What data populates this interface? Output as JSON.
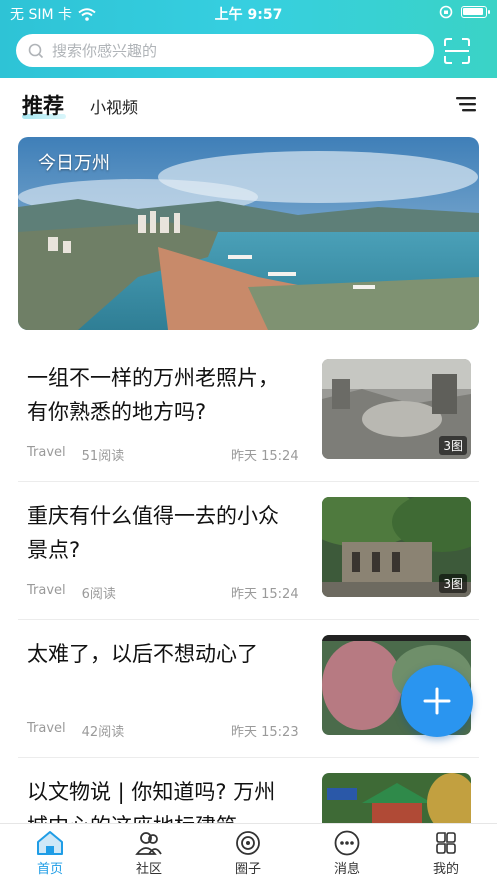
{
  "status_bar": {
    "carrier": "无 SIM 卡",
    "time": "上午 9:57"
  },
  "search": {
    "placeholder": "搜索你感兴趣的"
  },
  "tabs": {
    "main": "推荐",
    "second": "小视频"
  },
  "banner": {
    "title": "今日万州"
  },
  "feed": [
    {
      "title": "一组不一样的万州老照片，有你熟悉的地方吗?",
      "category": "Travel",
      "reads": "51阅读",
      "time": "昨天 15:24",
      "badge": "3图"
    },
    {
      "title": "重庆有什么值得一去的小众景点?",
      "category": "Travel",
      "reads": "6阅读",
      "time": "昨天 15:24",
      "badge": "3图"
    },
    {
      "title": "太难了，以后不想动心了",
      "category": "Travel",
      "reads": "42阅读",
      "time": "昨天 15:23",
      "badge": ""
    },
    {
      "title": "以文物说 | 你知道吗? 万州城中心的这座地标建筑",
      "category": "",
      "reads": "",
      "time": "",
      "badge": ""
    }
  ],
  "bottom_nav": [
    {
      "label": "首页",
      "icon": "home-icon",
      "active": true
    },
    {
      "label": "社区",
      "icon": "community-icon",
      "active": false
    },
    {
      "label": "圈子",
      "icon": "circle-icon",
      "active": false
    },
    {
      "label": "消息",
      "icon": "message-icon",
      "active": false
    },
    {
      "label": "我的",
      "icon": "profile-icon",
      "active": false
    }
  ],
  "colors": {
    "accent": "#1f9de6",
    "header_gradient_start": "#2ec3d6",
    "fab": "#2a95f0"
  }
}
